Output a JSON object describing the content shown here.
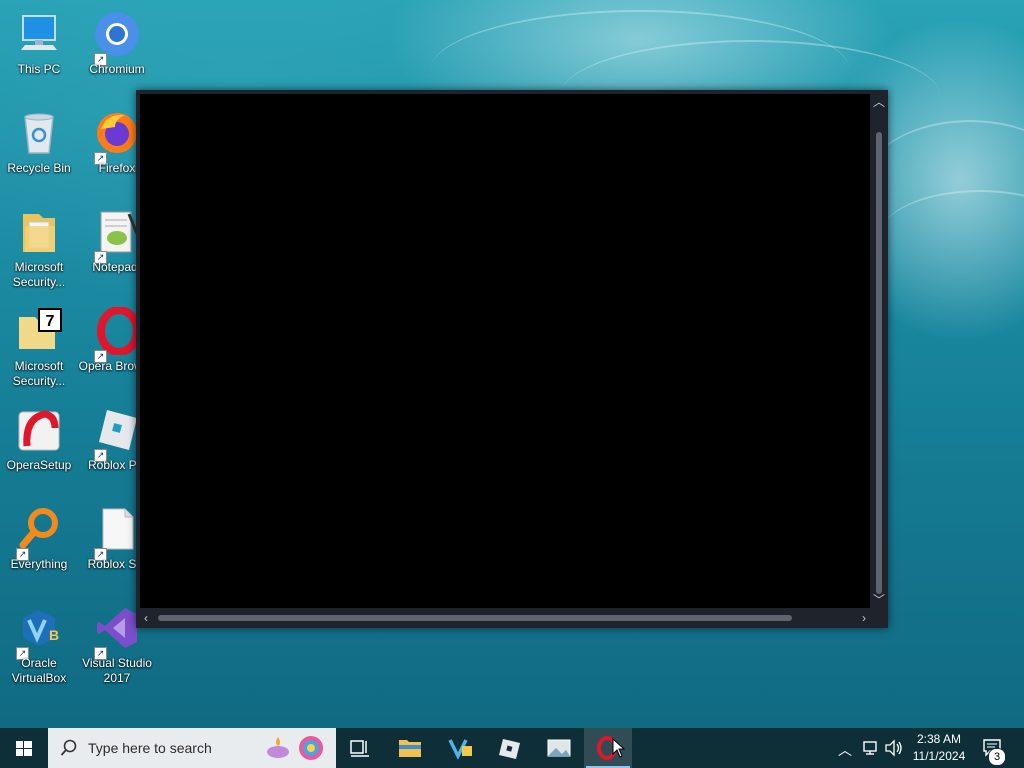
{
  "desktop_icons": {
    "this_pc": "This PC",
    "chromium": "Chromium",
    "recycle_bin": "Recycle Bin",
    "firefox": "Firefox",
    "ms_security_1": "Microsoft Security...",
    "notepad": "Notepad-",
    "ms_security_2": "Microsoft Security...",
    "opera_browser": "Opera Browse",
    "opera_setup": "OperaSetup",
    "roblox_player": "Roblox Pla",
    "everything": "Everything",
    "roblox_studio": "Roblox Stu",
    "oracle_vbox": "Oracle VirtualBox",
    "visual_studio": "Visual Studio 2017"
  },
  "taskbar": {
    "search_placeholder": "Type here to search",
    "time": "2:38 AM",
    "date": "11/1/2024",
    "notification_count": "3"
  },
  "colors": {
    "taskbar": "#0e2f38",
    "window_frame": "#1f242c",
    "opera_red": "#e0162b"
  }
}
